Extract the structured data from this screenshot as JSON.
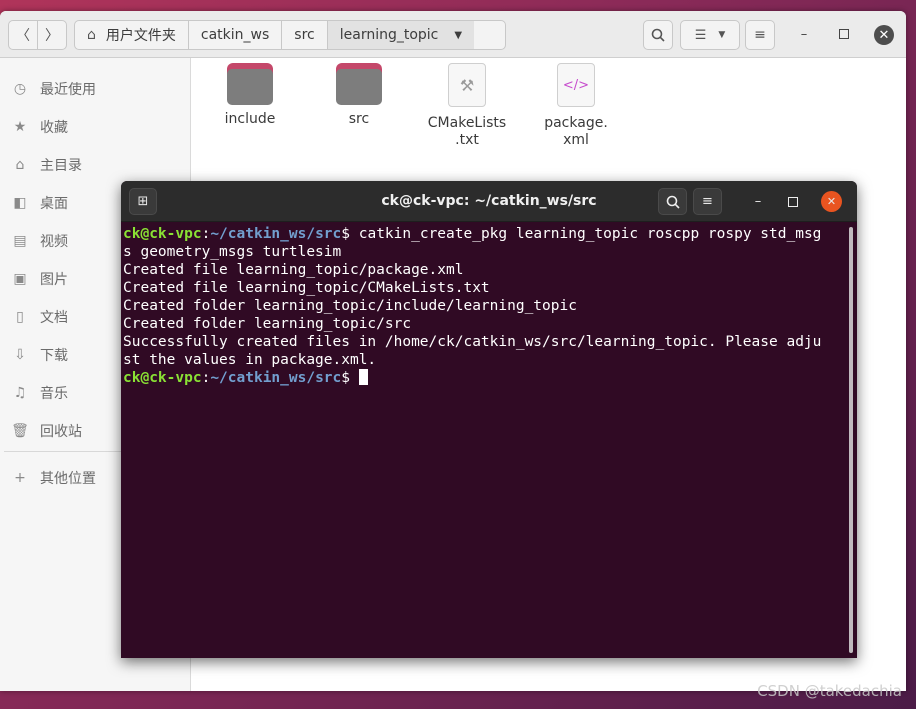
{
  "file_manager": {
    "breadcrumb": [
      "用户文件夹",
      "catkin_ws",
      "src",
      "learning_topic"
    ],
    "sidebar": [
      {
        "label": "最近使用",
        "icon": "clock-icon"
      },
      {
        "label": "收藏",
        "icon": "star-icon"
      },
      {
        "label": "主目录",
        "icon": "home-icon"
      },
      {
        "label": "桌面",
        "icon": "desktop-icon"
      },
      {
        "label": "视频",
        "icon": "video-icon"
      },
      {
        "label": "图片",
        "icon": "image-icon"
      },
      {
        "label": "文档",
        "icon": "document-icon"
      },
      {
        "label": "下载",
        "icon": "download-icon"
      },
      {
        "label": "音乐",
        "icon": "music-icon"
      },
      {
        "label": "回收站",
        "icon": "trash-icon"
      }
    ],
    "other_locations": "其他位置",
    "files": [
      {
        "name": "include",
        "type": "folder"
      },
      {
        "name": "src",
        "type": "folder"
      },
      {
        "name": "CMakeLists\n.txt",
        "type": "cmake"
      },
      {
        "name": "package.\nxml",
        "type": "xml"
      }
    ]
  },
  "terminal": {
    "title": "ck@ck-vpc: ~/catkin_ws/src",
    "prompt_user": "ck@ck-vpc",
    "prompt_path": "~/catkin_ws/src",
    "command": "catkin_create_pkg learning_topic roscpp rospy std_msgs geometry_msgs turtlesim",
    "command_line1": "catkin_create_pkg learning_topic roscpp rospy std_msg",
    "command_line2": "s geometry_msgs turtlesim",
    "output": [
      "Created file learning_topic/package.xml",
      "Created file learning_topic/CMakeLists.txt",
      "Created folder learning_topic/include/learning_topic",
      "Created folder learning_topic/src",
      "Successfully created files in /home/ck/catkin_ws/src/learning_topic. Please adju",
      "st the values in package.xml."
    ]
  },
  "watermark": "CSDN @takedachia",
  "colors": {
    "terminal_bg": "#300a24",
    "prompt_user": "#8ae234",
    "prompt_path": "#729fcf",
    "folder_tab": "#c4486a"
  }
}
